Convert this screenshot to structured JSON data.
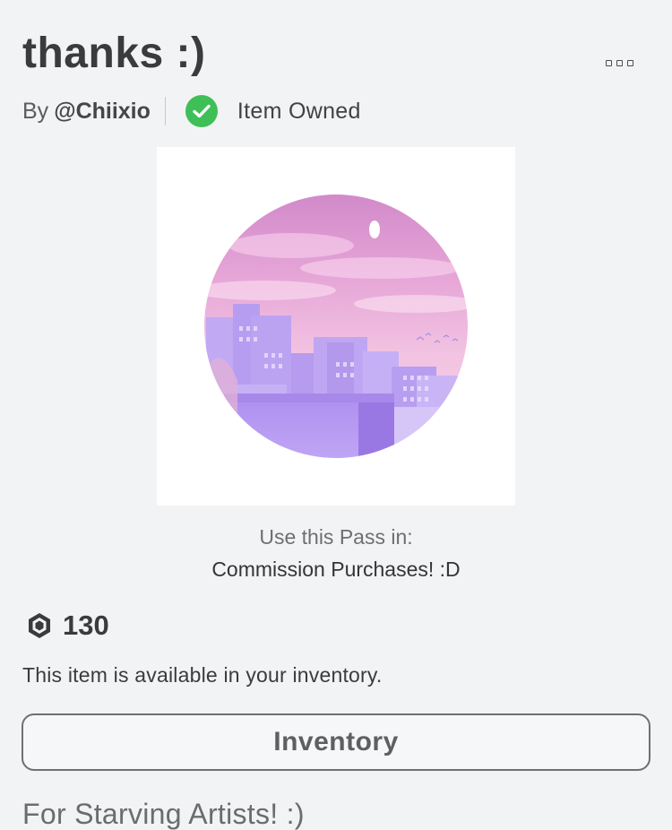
{
  "item": {
    "title": "thanks :)",
    "by_label": "By",
    "creator": "@Chiixio",
    "owned_label": "Item Owned"
  },
  "thumbnail": {
    "description_icon": "pink-city-sunset-circle"
  },
  "use_in": {
    "label": "Use this Pass in:",
    "place": "Commission Purchases! :D"
  },
  "price": {
    "icon": "robux-icon",
    "amount": "130"
  },
  "availability_text": "This item is available in your inventory.",
  "inventory_button_label": "Inventory",
  "description": "For Starving Artists! :)",
  "colors": {
    "owned_green": "#3fbf57",
    "background": "#f2f3f5"
  }
}
